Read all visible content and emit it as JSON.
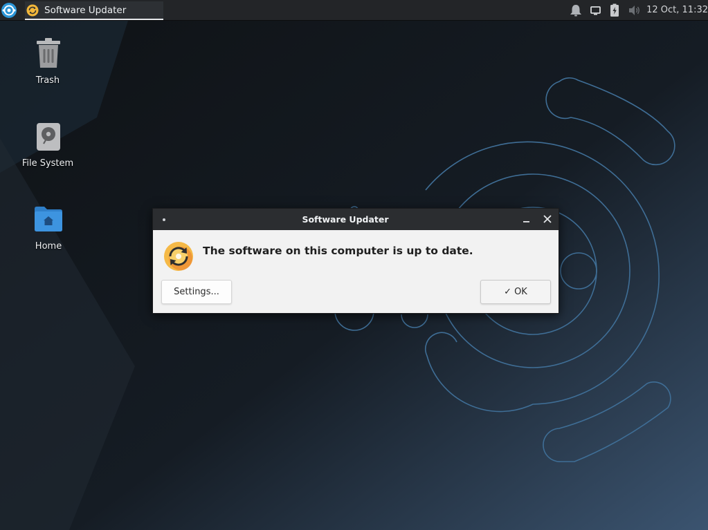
{
  "panel": {
    "taskbar_item": {
      "label": "Software Updater"
    },
    "clock": "12 Oct, 11:32",
    "tray_icons": [
      "notification-bell-icon",
      "display-icon",
      "battery-charging-icon",
      "volume-muted-icon"
    ]
  },
  "desktop": {
    "icons": [
      {
        "label": "Trash",
        "icon": "trash-icon"
      },
      {
        "label": "File System",
        "icon": "drive-icon"
      },
      {
        "label": "Home",
        "icon": "home-folder-icon"
      }
    ]
  },
  "dialog": {
    "title": "Software Updater",
    "message": "The software on this computer is up to date.",
    "settings_label": "Settings...",
    "ok_label": "OK"
  },
  "colors": {
    "background": "#111417",
    "panel": "#232528",
    "dialog_bg": "#f2f2f2",
    "titlebar": "#2b2d30",
    "wallpaper_rings": "#3f6e96",
    "updater_orange": "#f2a63a"
  }
}
